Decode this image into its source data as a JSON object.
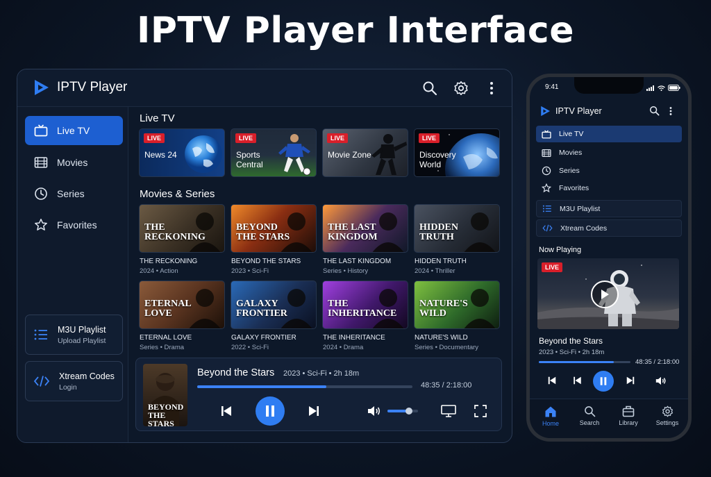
{
  "hero_title": "IPTV Player Interface",
  "colors": {
    "accent": "#1d5fd1",
    "accent_light": "#3b82f6",
    "live": "#d91f2a",
    "panel": "#0d1829"
  },
  "tablet": {
    "app_name": "IPTV Player",
    "header_icons": [
      "search-icon",
      "gear-icon",
      "more-vertical-icon"
    ],
    "nav": [
      {
        "label": "Live TV",
        "icon": "tv-icon",
        "active": true
      },
      {
        "label": "Movies",
        "icon": "film-icon",
        "active": false
      },
      {
        "label": "Series",
        "icon": "clock-icon",
        "active": false
      },
      {
        "label": "Favorites",
        "icon": "star-icon",
        "active": false
      }
    ],
    "sources": [
      {
        "title": "M3U Playlist",
        "subtitle": "Upload Playlist",
        "icon": "list-icon"
      },
      {
        "title": "Xtream Codes",
        "subtitle": "Login",
        "icon": "code-icon"
      }
    ],
    "live_section": "Live TV",
    "live_badge": "LIVE",
    "live_channels": [
      {
        "name": "News 24"
      },
      {
        "name": "Sports Central"
      },
      {
        "name": "Movie Zone"
      },
      {
        "name": "Discovery World"
      }
    ],
    "movies_section": "Movies & Series",
    "movies": [
      {
        "poster_line1": "THE",
        "poster_line2": "RECKONING",
        "title": "THE RECKONING",
        "meta": "2024 • Action"
      },
      {
        "poster_line1": "BEYOND",
        "poster_line2": "THE STARS",
        "title": "BEYOND THE STARS",
        "meta": "2023 • Sci-Fi"
      },
      {
        "poster_line1": "THE LAST",
        "poster_line2": "KINGDOM",
        "title": "THE LAST KINGDOM",
        "meta": "Series • History"
      },
      {
        "poster_line1": "HIDDEN",
        "poster_line2": "TRUTH",
        "title": "HIDDEN TRUTH",
        "meta": "2024 • Thriller"
      },
      {
        "poster_line1": "ETERNAL",
        "poster_line2": "LOVE",
        "title": "ETERNAL LOVE",
        "meta": "Series • Drama"
      },
      {
        "poster_line1": "GALAXY",
        "poster_line2": "FRONTIER",
        "title": "GALAXY FRONTIER",
        "meta": "2022 • Sci-Fi"
      },
      {
        "poster_line1": "THE",
        "poster_line2": "INHERITANCE",
        "title": "THE INHERITANCE",
        "meta": "2024 • Drama"
      },
      {
        "poster_line1": "NATURE'S",
        "poster_line2": "WILD",
        "title": "NATURE'S WILD",
        "meta": "Series • Documentary"
      }
    ],
    "player": {
      "poster_line1": "BEYOND",
      "poster_line2": "THE STARS",
      "title": "Beyond the Stars",
      "meta": "2023 • Sci-Fi • 2h 18m",
      "time": "48:35 / 2:18:00",
      "progress": 0.6,
      "volume": 0.7
    }
  },
  "phone": {
    "clock": "9:41",
    "app_name": "IPTV Player",
    "nav": [
      {
        "label": "Live TV",
        "icon": "tv-icon",
        "active": true
      },
      {
        "label": "Movies",
        "icon": "film-icon",
        "active": false
      },
      {
        "label": "Series",
        "icon": "clock-icon",
        "active": false
      },
      {
        "label": "Favorites",
        "icon": "star-icon",
        "active": false
      }
    ],
    "sources": [
      {
        "label": "M3U Playlist",
        "icon": "list-icon"
      },
      {
        "label": "Xtream Codes",
        "icon": "code-icon"
      }
    ],
    "now_playing_label": "Now Playing",
    "live_badge": "LIVE",
    "title": "Beyond the Stars",
    "meta": "2023 • Sci-Fi • 2h 18m",
    "time": "48:35 / 2:18:00",
    "progress": 0.82,
    "tabs": [
      {
        "label": "Home",
        "icon": "home-icon",
        "active": true
      },
      {
        "label": "Search",
        "icon": "search-icon",
        "active": false
      },
      {
        "label": "Library",
        "icon": "library-icon",
        "active": false
      },
      {
        "label": "Settings",
        "icon": "gear-icon",
        "active": false
      }
    ]
  }
}
